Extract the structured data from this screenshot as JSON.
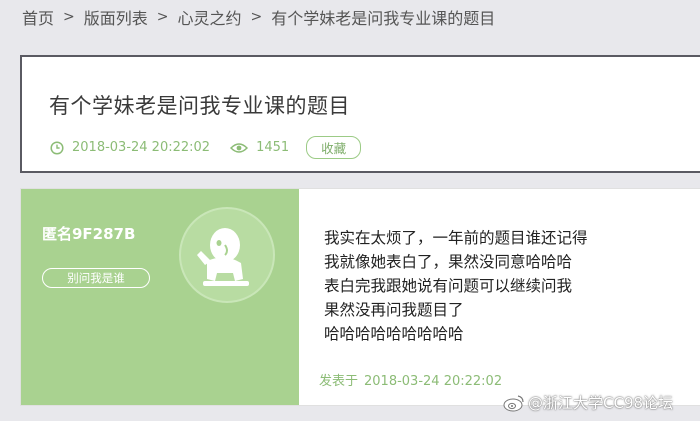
{
  "breadcrumb": {
    "items": [
      "首页",
      "版面列表",
      "心灵之约",
      "有个学妹老是问我专业课的题目"
    ],
    "separator": ">"
  },
  "topic": {
    "title": "有个学妹老是问我专业课的题目",
    "datetime": "2018-03-24 20:22:02",
    "views": "1451",
    "favorite_label": "收藏"
  },
  "post": {
    "author_name": "匿名9F287B",
    "author_tag": "别问我是谁",
    "content_lines": [
      "我实在太烦了，一年前的题目谁还记得",
      "我就像她表白了，果然没同意哈哈哈",
      "表白完我跟她说有问题可以继续问我",
      "果然没再问我题目了",
      "哈哈哈哈哈哈哈哈哈"
    ],
    "posted_label": "发表于",
    "posted_datetime": "2018-03-24 20:22:02"
  },
  "watermark": "@浙江大学CC98论坛",
  "colors": {
    "accent_green": "#a9d290",
    "meta_green": "#8cbc76",
    "background": "#e8e8ec"
  },
  "icons": [
    "clock-icon",
    "eye-icon",
    "avatar-icon",
    "weibo-icon"
  ]
}
